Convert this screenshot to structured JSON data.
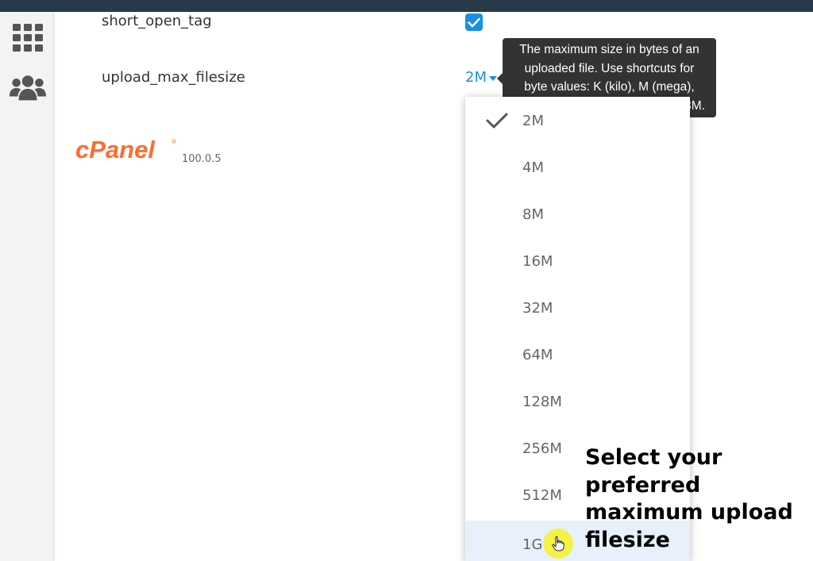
{
  "settings": {
    "short_open_tag": {
      "label": "short_open_tag",
      "checked": true
    },
    "upload_max_filesize": {
      "label": "upload_max_filesize",
      "selected": "2M",
      "tooltip_lines": [
        "The maximum size in bytes of an",
        "uploaded file. Use shortcuts for",
        "byte values: K (kilo), M (mega),",
        "3M."
      ]
    }
  },
  "brand": {
    "logo_text": "cPanel",
    "version": "100.0.5",
    "color": "#ff6c2c"
  },
  "dropdown": {
    "options": [
      "2M",
      "4M",
      "8M",
      "16M",
      "32M",
      "64M",
      "128M",
      "256M",
      "512M",
      "1G"
    ],
    "selected_index": 0,
    "hover_index": 9
  },
  "annotation": {
    "text": "Select your preferred maximum upload filesize"
  },
  "icons": {
    "sidebar": [
      "grid-icon",
      "users-icon"
    ],
    "check": "checkmark-icon",
    "cursor": "hand-pointer-icon"
  },
  "colors": {
    "accent": "#1a8fe3",
    "topbar": "#293a4a",
    "tooltip_bg": "#333333",
    "highlight": "#f4f338"
  }
}
